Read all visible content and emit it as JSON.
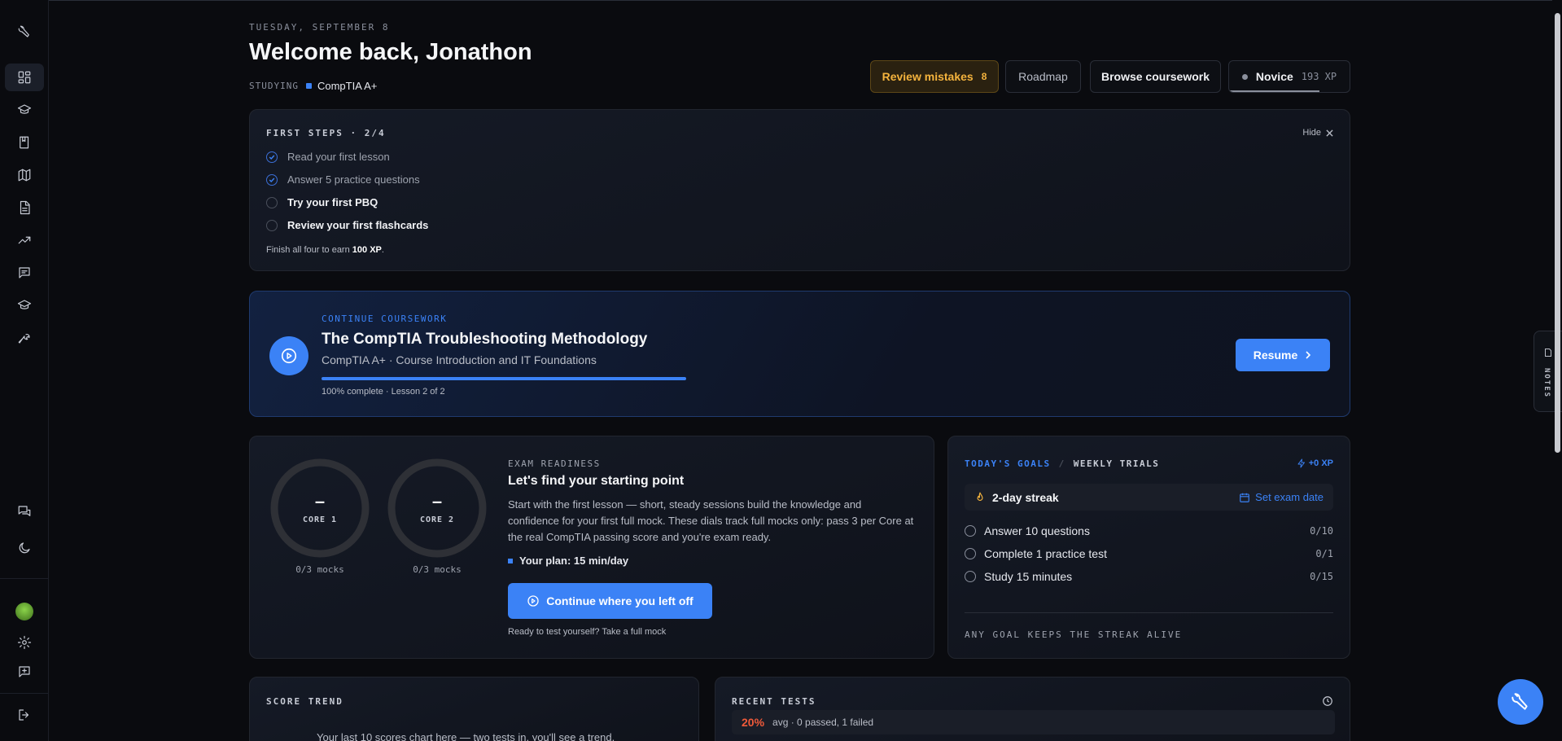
{
  "header": {
    "date": "TUESDAY, SEPTEMBER 8",
    "welcome": "Welcome back, Jonathon",
    "studying_label": "STUDYING",
    "course": "CompTIA A+"
  },
  "actions": {
    "review_label": "Review mistakes",
    "review_count": "8",
    "roadmap_label": "Roadmap",
    "browse_label": "Browse coursework",
    "rank_label": "Novice",
    "rank_xp": "193 XP",
    "rank_progress": 0.75
  },
  "first_steps": {
    "title": "FIRST STEPS · 2/4",
    "hide_label": "Hide",
    "steps": [
      {
        "label": "Read your first lesson",
        "done": true
      },
      {
        "label": "Answer 5 practice questions",
        "done": true
      },
      {
        "label": "Try your first PBQ",
        "done": false
      },
      {
        "label": "Review your first flashcards",
        "done": false
      }
    ],
    "finish_prefix": "Finish all four to earn",
    "finish_reward": "100 XP",
    "finish_suffix": "."
  },
  "continue": {
    "overline": "CONTINUE COURSEWORK",
    "title": "The CompTIA Troubleshooting Methodology",
    "subtitle": "CompTIA A+ · Course Introduction and IT Foundations",
    "progress": 100,
    "status": "100% complete · Lesson 2 of 2",
    "resume_label": "Resume"
  },
  "readiness": {
    "overline": "EXAM READINESS",
    "heading": "Let's find your starting point",
    "body": "Start with the first lesson — short, steady sessions build the knowledge and confidence for your first full mock. These dials track full mocks only: pass 3 per Core at the real CompTIA passing score and you're exam ready.",
    "plan": "Your plan: 15 min/day",
    "cta_label": "Continue where you left off",
    "ready_text": "Ready to test yourself? Take a full mock",
    "dials": [
      {
        "value": "–",
        "label": "CORE 1",
        "mocks": "0/3 mocks"
      },
      {
        "value": "–",
        "label": "CORE 2",
        "mocks": "0/3 mocks"
      }
    ]
  },
  "goals": {
    "tab_active": "TODAY'S GOALS",
    "separator": "/",
    "tab_other": "WEEKLY TRIALS",
    "xp_label": "+0 XP",
    "streak": "2-day streak",
    "exam_date_label": "Set exam date",
    "items": [
      {
        "label": "Answer 10 questions",
        "count": "0/10"
      },
      {
        "label": "Complete 1 practice test",
        "count": "0/1"
      },
      {
        "label": "Study 15 minutes",
        "count": "0/15"
      }
    ],
    "footer": "ANY GOAL KEEPS THE STREAK ALIVE"
  },
  "score_trend": {
    "title": "SCORE TREND",
    "message": "Your last 10 scores chart here — two tests in, you'll see a trend."
  },
  "recent_tests": {
    "title": "RECENT TESTS",
    "avg_pct": "20%",
    "avg_text": "avg · 0 passed, 1 failed"
  },
  "notes": {
    "label": "NOTES"
  },
  "colors": {
    "accent": "#3b82f6",
    "warning": "#f4b33d",
    "danger": "#f05a3a"
  }
}
